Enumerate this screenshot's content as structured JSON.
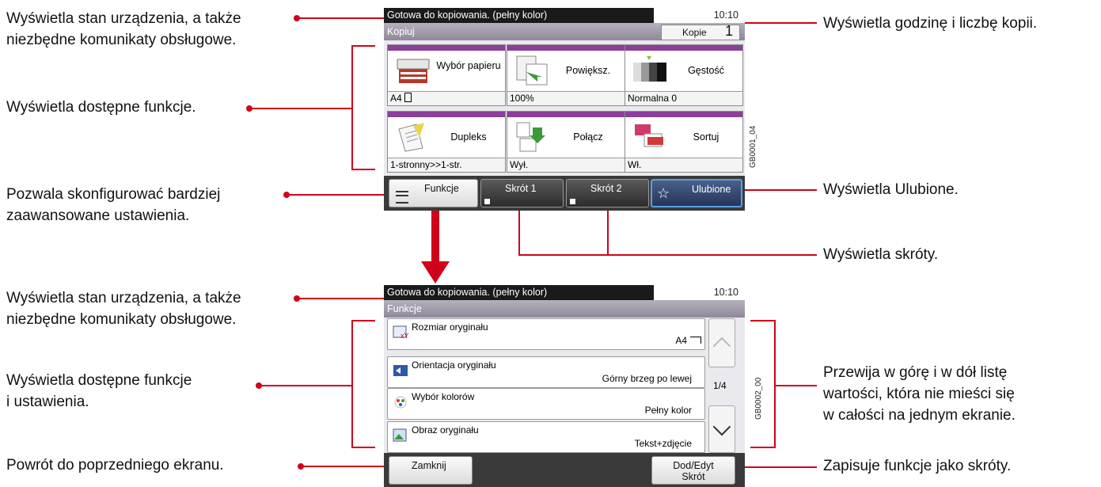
{
  "callouts": {
    "status_1": "Wyświetla stan urządzenia, a także",
    "status_2": "niezbędne komunikaty obsługowe.",
    "functions": "Wyświetla dostępne funkcje.",
    "advanced_1": "Pozwala skonfigurować bardziej",
    "advanced_2": "zaawansowane ustawienia.",
    "time_copies": "Wyświetla godzinę i liczbę kopii.",
    "favorites": "Wyświetla Ulubione.",
    "shortcuts": "Wyświetla skróty.",
    "status2_1": "Wyświetla stan urządzenia, a także",
    "status2_2": "niezbędne komunikaty obsługowe.",
    "functions2_1": "Wyświetla dostępne funkcje",
    "functions2_2": "i ustawienia.",
    "back": "Powrót do poprzedniego ekranu.",
    "scroll_1": "Przewija w górę i w dół listę",
    "scroll_2": "wartości, która nie mieści się",
    "scroll_3": "w całości na jednym ekranie.",
    "save": "Zapisuje funkcje jako skróty."
  },
  "screen1": {
    "status": "Gotowa do kopiowania. (pełny kolor)",
    "time": "10:10",
    "title": "Kopiuj",
    "copies_label": "Kopie",
    "copies_value": "1",
    "side_code": "GB0001_04",
    "tiles": [
      {
        "name": "Wybór papieru",
        "value": "A4",
        "icon": "paper-tray-icon"
      },
      {
        "name": "Powiększ.",
        "value": "100%",
        "icon": "zoom-icon"
      },
      {
        "name": "Gęstość",
        "value": "Normalna 0",
        "icon": "density-icon"
      },
      {
        "name": "Dupleks",
        "value": "1-stronny>>1-str.",
        "icon": "duplex-icon"
      },
      {
        "name": "Połącz",
        "value": "Wył.",
        "icon": "combine-icon"
      },
      {
        "name": "Sortuj",
        "value": "Wł.",
        "icon": "collate-icon"
      }
    ],
    "buttons": {
      "functions": "Funkcje",
      "shortcut1": "Skrót 1",
      "shortcut2": "Skrót 2",
      "favorites": "Ulubione"
    }
  },
  "screen2": {
    "status": "Gotowa do kopiowania. (pełny kolor)",
    "time": "10:10",
    "title": "Funkcje",
    "side_code": "GB0002_00",
    "page": "1/4",
    "rows": [
      {
        "name": "Rozmiar oryginału",
        "value": "A4",
        "icon": "original-size-icon"
      },
      {
        "name": "Orientacja oryginału",
        "value": "Górny brzeg po lewej",
        "icon": "orientation-icon"
      },
      {
        "name": "Wybór kolorów",
        "value": "Pełny kolor",
        "icon": "color-select-icon"
      },
      {
        "name": "Obraz oryginału",
        "value": "Tekst+zdjęcie",
        "icon": "original-image-icon"
      }
    ],
    "close": "Zamknij",
    "add_edit_1": "Dod/Edyt",
    "add_edit_2": "Skrót"
  },
  "colors": {
    "accent": "#d0021b",
    "tile_header": "#8b3f9a",
    "favorite_border": "#5aa0e0"
  }
}
